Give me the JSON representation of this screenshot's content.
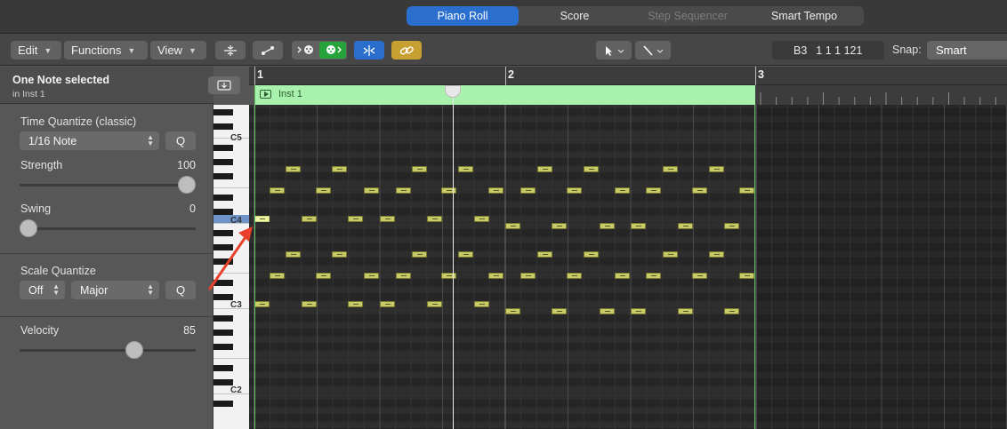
{
  "tabs": [
    {
      "label": "Piano Roll",
      "state": "active"
    },
    {
      "label": "Score",
      "state": "normal"
    },
    {
      "label": "Step Sequencer",
      "state": "disabled"
    },
    {
      "label": "Smart Tempo",
      "state": "normal"
    }
  ],
  "toolbar": {
    "edit_label": "Edit",
    "functions_label": "Functions",
    "view_label": "View",
    "lcd_note": "B3",
    "lcd_position": "1 1 1 121",
    "snap_label": "Snap:",
    "snap_value": "Smart"
  },
  "inspector": {
    "selection_title": "One Note selected",
    "selection_sub": "in Inst 1",
    "time_quantize_label": "Time Quantize (classic)",
    "time_quantize_value": "1/16 Note",
    "q_label": "Q",
    "strength_label": "Strength",
    "strength_value": "100",
    "swing_label": "Swing",
    "swing_value": "0",
    "scale_quantize_label": "Scale Quantize",
    "scale_off": "Off",
    "scale_major": "Major",
    "velocity_label": "Velocity",
    "velocity_value": "85",
    "strength_level": 1.0,
    "swing_level": 0.0,
    "velocity_level": 0.67
  },
  "piano": {
    "labels": [
      "C5",
      "C4",
      "C3",
      "C2"
    ]
  },
  "ruler": {
    "bars": [
      "1",
      "2",
      "3"
    ]
  },
  "region": {
    "name": "Inst 1",
    "color": "#a9f2ad"
  },
  "colors": {
    "accent": "#2b6fce",
    "note": "#c8c968",
    "note_selected": "#eff7a5",
    "annotation_arrow": "#e8402b"
  }
}
